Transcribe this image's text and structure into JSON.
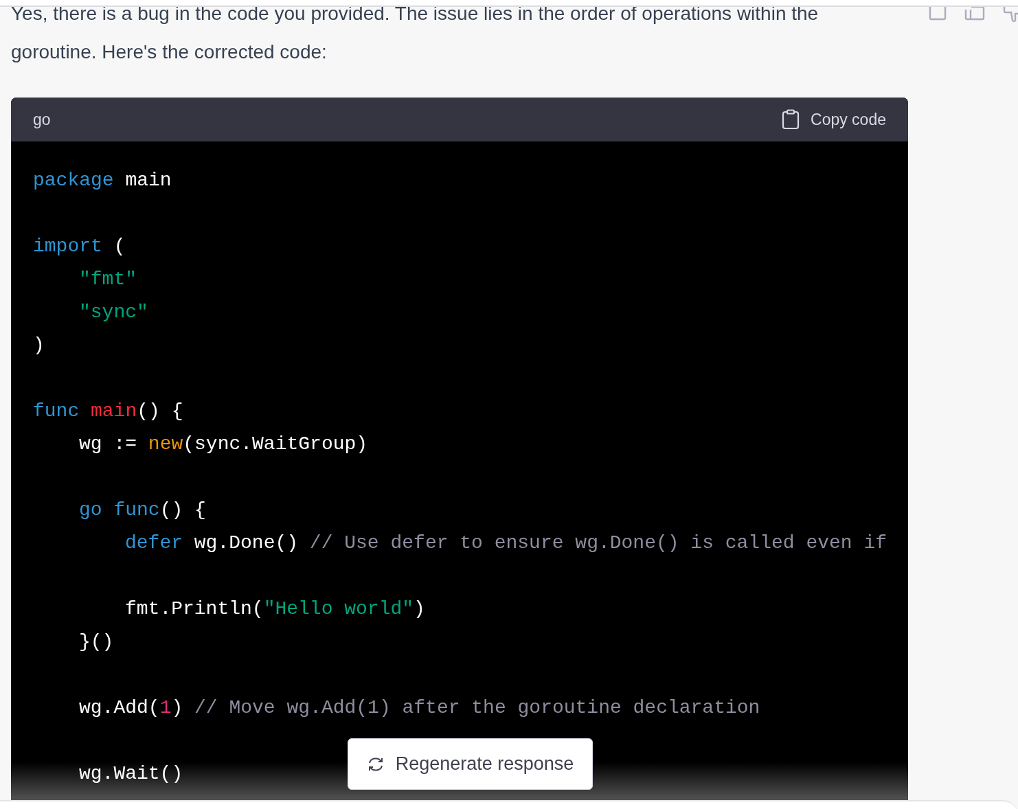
{
  "message": {
    "text": "Yes, there is a bug in the code you provided. The issue lies in the order of operations within the goroutine. Here's the corrected code:"
  },
  "code_block": {
    "language": "go",
    "copy_label": "Copy code",
    "lines": [
      {
        "kind": "code",
        "tokens": [
          {
            "kind": "keyword",
            "text": "package"
          },
          {
            "kind": "plain",
            "text": " main"
          }
        ]
      },
      {
        "kind": "blank"
      },
      {
        "kind": "code",
        "tokens": [
          {
            "kind": "keyword",
            "text": "import"
          },
          {
            "kind": "plain",
            "text": " ("
          }
        ],
        "children": [
          {
            "kind": "code",
            "tokens": [
              {
                "kind": "string",
                "text": "\"fmt\""
              }
            ]
          },
          {
            "kind": "code",
            "tokens": [
              {
                "kind": "string",
                "text": "\"sync\""
              }
            ]
          }
        ]
      },
      {
        "kind": "code",
        "tokens": [
          {
            "kind": "plain",
            "text": ")"
          }
        ]
      },
      {
        "kind": "blank"
      },
      {
        "kind": "code",
        "tokens": [
          {
            "kind": "keyword",
            "text": "func "
          },
          {
            "kind": "function",
            "text": "main"
          },
          {
            "kind": "plain",
            "text": "() {"
          }
        ],
        "children": [
          {
            "kind": "code",
            "tokens": [
              {
                "kind": "plain",
                "text": "wg := "
              },
              {
                "kind": "builtin",
                "text": "new"
              },
              {
                "kind": "plain",
                "text": "(sync.WaitGroup)"
              }
            ]
          },
          {
            "kind": "blank"
          },
          {
            "kind": "code",
            "tokens": [
              {
                "kind": "keyword",
                "text": "go func"
              },
              {
                "kind": "plain",
                "text": "() {"
              }
            ],
            "children": [
              {
                "kind": "code",
                "tokens": [
                  {
                    "kind": "keyword",
                    "text": "defer"
                  },
                  {
                    "kind": "plain",
                    "text": " wg.Done() "
                  },
                  {
                    "kind": "comment",
                    "text": "// Use defer to ensure wg.Done() is called even if"
                  }
                ]
              },
              {
                "kind": "blank"
              },
              {
                "kind": "code",
                "tokens": [
                  {
                    "kind": "plain",
                    "text": "fmt.Println("
                  },
                  {
                    "kind": "string",
                    "text": "\"Hello world\""
                  },
                  {
                    "kind": "plain",
                    "text": ")"
                  }
                ]
              }
            ]
          },
          {
            "kind": "code",
            "tokens": [
              {
                "kind": "plain",
                "text": "}()"
              }
            ]
          },
          {
            "kind": "blank"
          },
          {
            "kind": "code",
            "tokens": [
              {
                "kind": "plain",
                "text": "wg.Add("
              },
              {
                "kind": "number",
                "text": "1"
              },
              {
                "kind": "plain",
                "text": ") "
              },
              {
                "kind": "comment",
                "text": "// Move wg.Add(1) after the goroutine declaration"
              }
            ]
          },
          {
            "kind": "blank"
          },
          {
            "kind": "code",
            "tokens": [
              {
                "kind": "plain",
                "text": "wg.Wait()"
              }
            ]
          }
        ]
      }
    ]
  },
  "regenerate_button": {
    "label": "Regenerate response"
  }
}
